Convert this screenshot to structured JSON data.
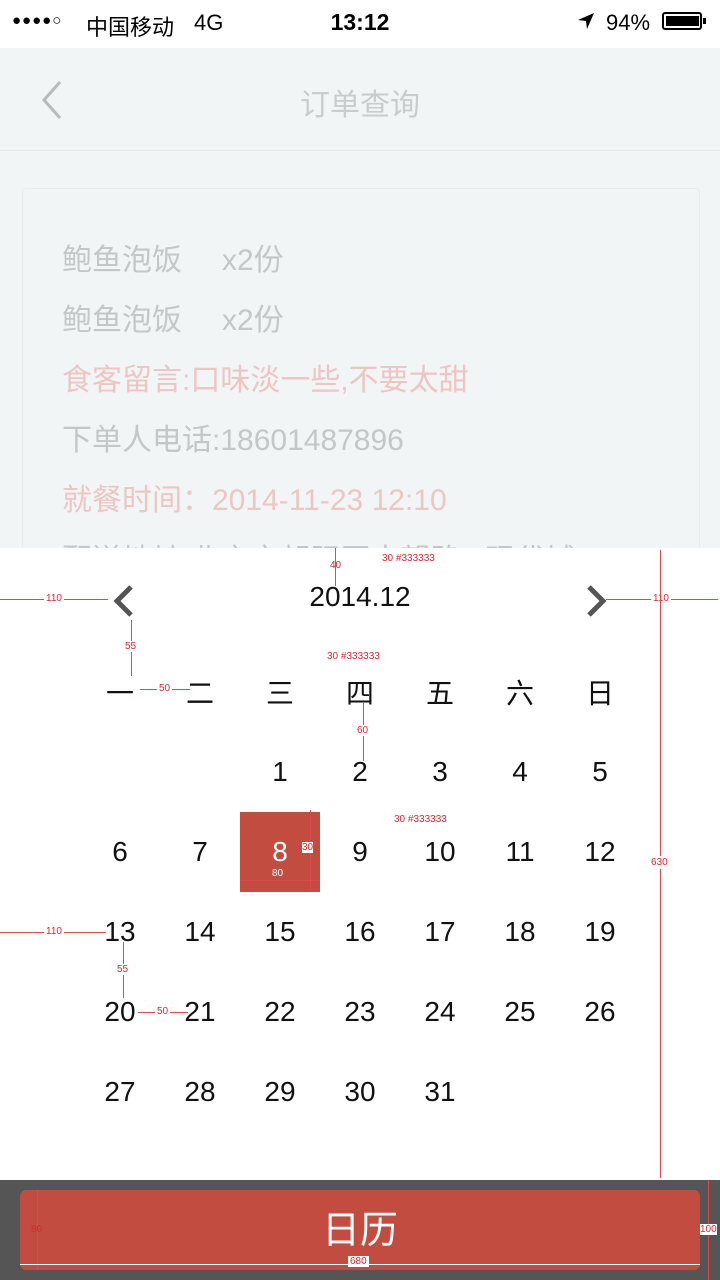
{
  "status_bar": {
    "signal": "●●●●○",
    "carrier": "中国移动",
    "network": "4G",
    "time": "13:12",
    "battery": "94%",
    "battery_level": 0.94
  },
  "background_page": {
    "title": "订单查询",
    "items": [
      {
        "name": "鲍鱼泡饭",
        "qty": "x2份"
      },
      {
        "name": "鲍鱼泡饭",
        "qty": "x2份"
      }
    ],
    "note": "食客留言:口味淡一些,不要太甜",
    "phone": "下单人电话:18601487896",
    "meal_time": "就餐时间：2014-11-23  12:10",
    "address": "配送地址:北京市朝阳区大望路...现代城"
  },
  "calendar": {
    "month": "2014.12",
    "weekdays": [
      "一",
      "二",
      "三",
      "四",
      "五",
      "六",
      "日"
    ],
    "days": [
      "1",
      "2",
      "3",
      "4",
      "5",
      "6",
      "7",
      "8",
      "9",
      "10",
      "11",
      "12",
      "13",
      "14",
      "15",
      "16",
      "17",
      "18",
      "19",
      "20",
      "21",
      "22",
      "23",
      "24",
      "25",
      "26",
      "27",
      "28",
      "29",
      "30",
      "31"
    ],
    "first_weekday_index": 2,
    "selected_day": "8"
  },
  "annotations": {
    "dims": [
      "40",
      "110",
      "110",
      "55",
      "50",
      "60",
      "630",
      "30",
      "80",
      "110",
      "55",
      "50",
      "80",
      "100",
      "680"
    ],
    "notes": [
      "30  #333333",
      "30  #333333",
      "30  #333333"
    ]
  },
  "bottom_button": {
    "label": "日历"
  },
  "colors": {
    "accent": "#c24c3f",
    "bottom_bar": "#555555",
    "text": "#333333",
    "annotation": "#d9272e"
  }
}
